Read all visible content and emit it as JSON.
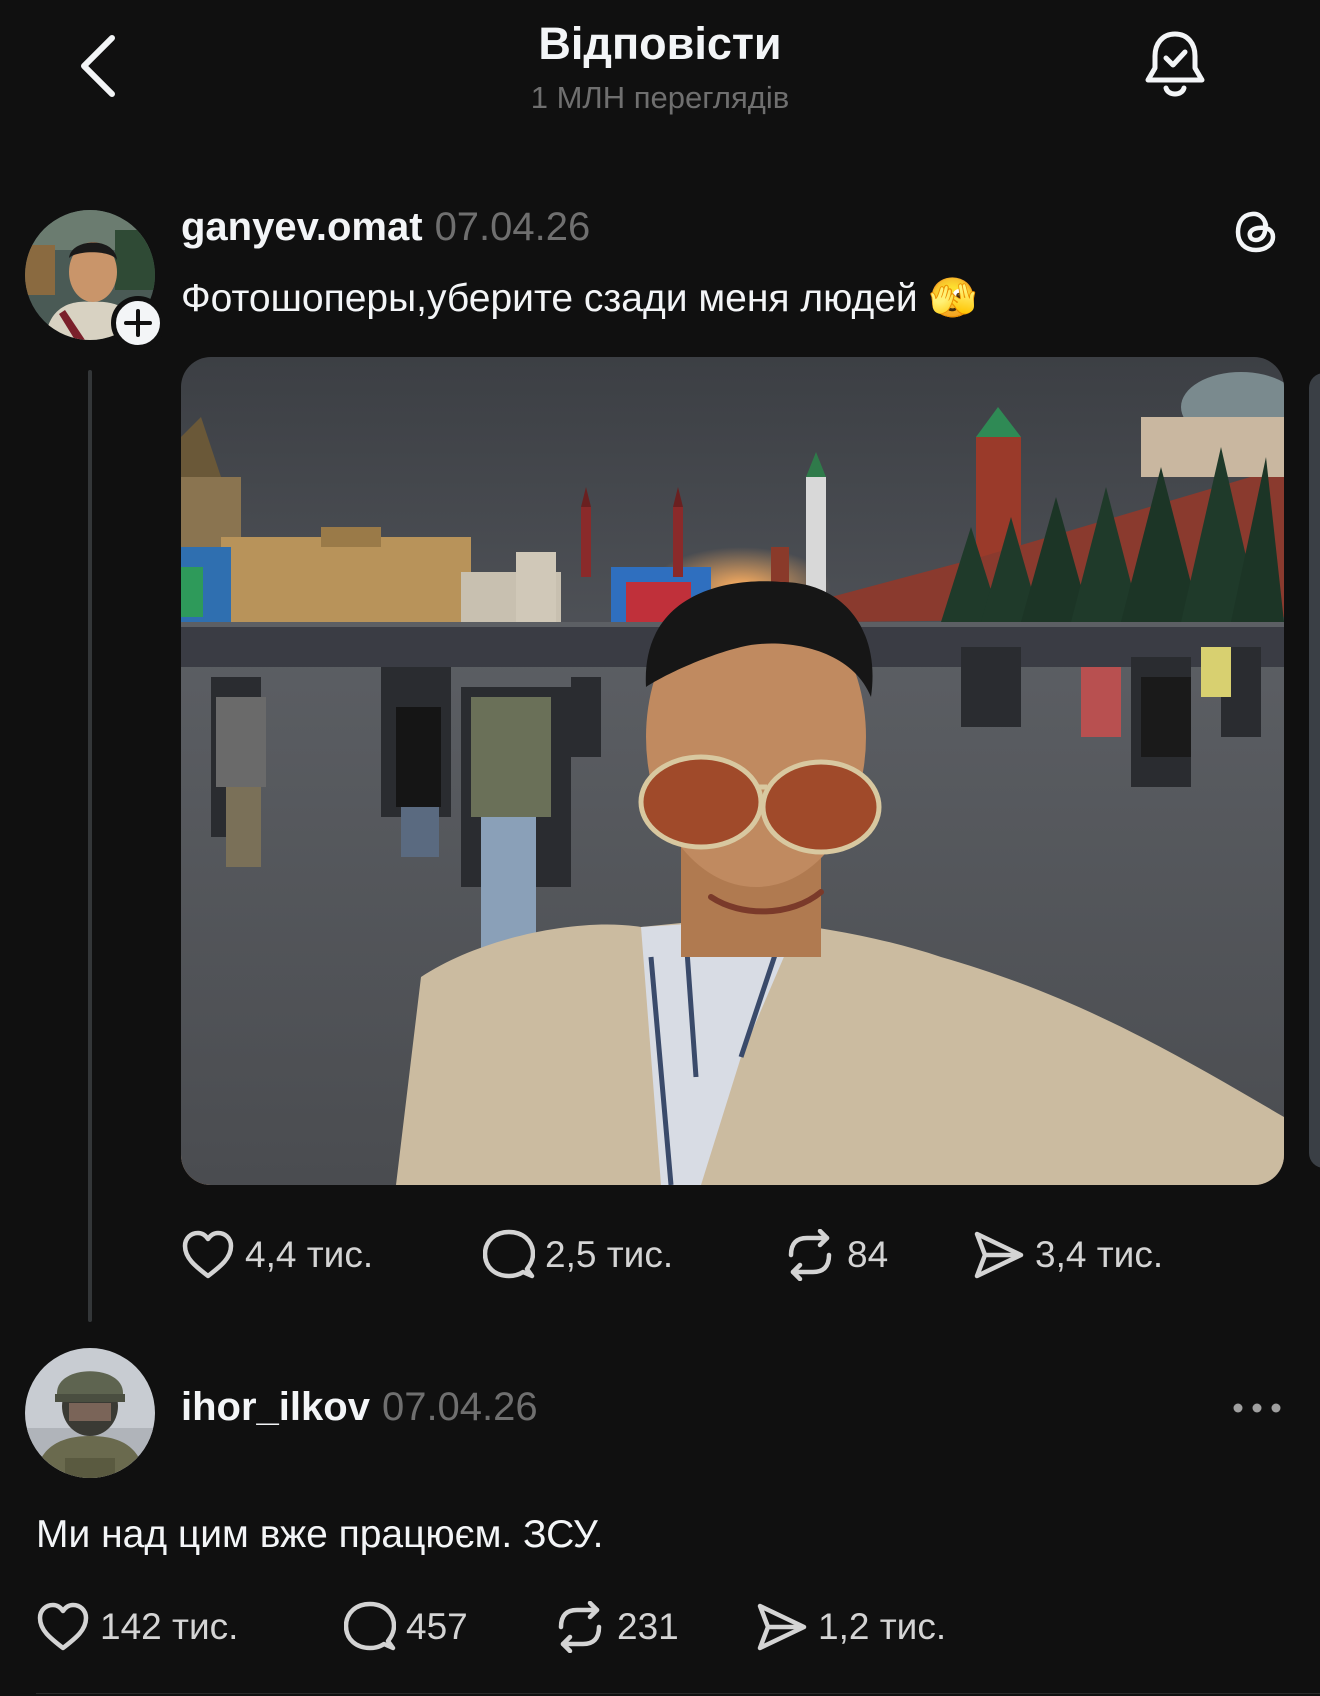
{
  "header": {
    "title": "Відповісти",
    "subtitle": "1 МЛН переглядів"
  },
  "post": {
    "username": "ganyev.omat",
    "date": "07.04.26",
    "text": "Фотошоперы,уберите сзади меня людей 🫣",
    "likes": "4,4 тис.",
    "replies": "2,5 тис.",
    "reposts": "84",
    "shares": "3,4 тис."
  },
  "reply": {
    "username": "ihor_ilkov",
    "date": "07.04.26",
    "text": "Ми над цим вже працюєм. ЗСУ.",
    "likes": "142 тис.",
    "replies": "457",
    "reposts": "231",
    "shares": "1,2 тис."
  },
  "icons": {
    "back": "chevron-left-icon",
    "notify": "bell-check-icon",
    "threads": "threads-logo-icon",
    "like": "heart-icon",
    "reply": "comment-icon",
    "repost": "repost-icon",
    "share": "send-icon",
    "more": "more-dots-icon",
    "follow": "plus-icon"
  }
}
